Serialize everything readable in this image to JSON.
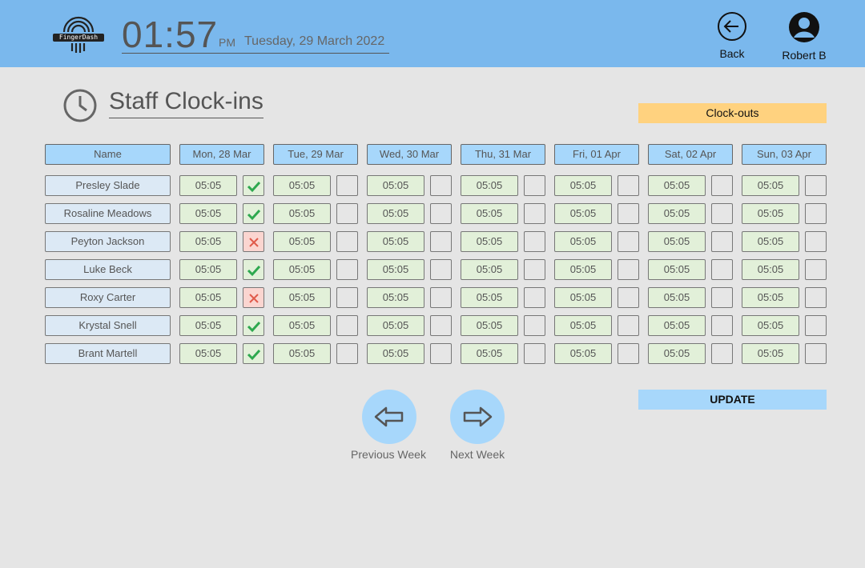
{
  "header": {
    "logo_text": "FingerDash",
    "time": "01:57",
    "ampm": "PM",
    "date": "Tuesday, 29 March 2022",
    "back_label": "Back",
    "user_name": "Robert B"
  },
  "page": {
    "title": "Staff Clock-ins",
    "clockouts_label": "Clock-outs",
    "update_label": "UPDATE",
    "prev_label": "Previous Week",
    "next_label": "Next Week"
  },
  "table": {
    "name_header": "Name",
    "days": [
      "Mon, 28 Mar",
      "Tue, 29 Mar",
      "Wed, 30 Mar",
      "Thu, 31 Mar",
      "Fri, 01 Apr",
      "Sat, 02 Apr",
      "Sun, 03 Apr"
    ],
    "rows": [
      {
        "name": "Presley Slade",
        "times": [
          "05:05",
          "05:05",
          "05:05",
          "05:05",
          "05:05",
          "05:05",
          "05:05"
        ],
        "status": [
          "yes",
          "",
          "",
          "",
          "",
          "",
          ""
        ]
      },
      {
        "name": "Rosaline Meadows",
        "times": [
          "05:05",
          "05:05",
          "05:05",
          "05:05",
          "05:05",
          "05:05",
          "05:05"
        ],
        "status": [
          "yes",
          "",
          "",
          "",
          "",
          "",
          ""
        ]
      },
      {
        "name": "Peyton Jackson",
        "times": [
          "05:05",
          "05:05",
          "05:05",
          "05:05",
          "05:05",
          "05:05",
          "05:05"
        ],
        "status": [
          "no",
          "",
          "",
          "",
          "",
          "",
          ""
        ]
      },
      {
        "name": "Luke Beck",
        "times": [
          "05:05",
          "05:05",
          "05:05",
          "05:05",
          "05:05",
          "05:05",
          "05:05"
        ],
        "status": [
          "yes",
          "",
          "",
          "",
          "",
          "",
          ""
        ]
      },
      {
        "name": "Roxy Carter",
        "times": [
          "05:05",
          "05:05",
          "05:05",
          "05:05",
          "05:05",
          "05:05",
          "05:05"
        ],
        "status": [
          "no",
          "",
          "",
          "",
          "",
          "",
          ""
        ]
      },
      {
        "name": "Krystal Snell",
        "times": [
          "05:05",
          "05:05",
          "05:05",
          "05:05",
          "05:05",
          "05:05",
          "05:05"
        ],
        "status": [
          "yes",
          "",
          "",
          "",
          "",
          "",
          ""
        ]
      },
      {
        "name": "Brant Martell",
        "times": [
          "05:05",
          "05:05",
          "05:05",
          "05:05",
          "05:05",
          "05:05",
          "05:05"
        ],
        "status": [
          "yes",
          "",
          "",
          "",
          "",
          "",
          ""
        ]
      }
    ]
  },
  "colors": {
    "topbar": "#7ab8ed",
    "header_cell": "#a7d7fb",
    "time_cell": "#e2f0d9",
    "check_green": "#2ea84f",
    "cross_red": "#e05a4a",
    "clockouts": "#ffd27f"
  }
}
